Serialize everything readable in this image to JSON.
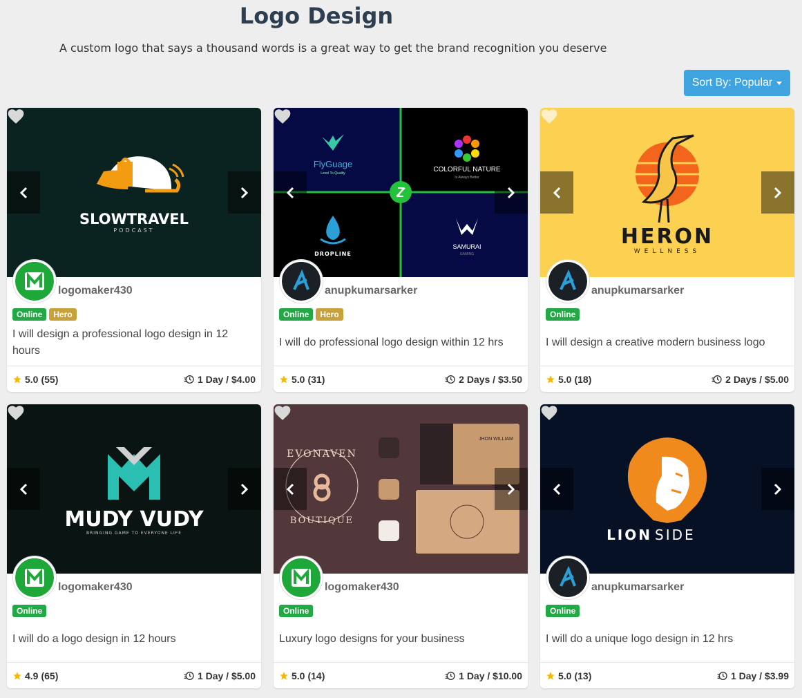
{
  "header": {
    "title": "Logo Design",
    "subtitle": "A custom logo that says a thousand words is a great way to get the brand recognition you deserve",
    "sort_label": "Sort By: Popular"
  },
  "colors": {
    "accent": "#3fa3e0",
    "online": "#22a845",
    "hero": "#c9a13b",
    "star": "#f5b800"
  },
  "cards": [
    {
      "image_text": {
        "line1": "SLOWTRAVEL",
        "line2": "PODCAST"
      },
      "seller": "logomaker430",
      "badges": {
        "online": "Online",
        "hero": "Hero"
      },
      "description": "I will design a professional logo design in 12 hours",
      "rating": "5.0",
      "reviews": "(55)",
      "delivery": "1 Day / $4.00",
      "favorited": false
    },
    {
      "image_text": {
        "a": "FlyGuage",
        "a_sub": "Level To Quality",
        "b": "COLORFUL NATURE",
        "b_sub": "Is Always Better",
        "c": "DROPLINE",
        "d": "SAMURAI",
        "d_sub": "GAMING"
      },
      "seller": "anupkumarsarker",
      "badges": {
        "online": "Online",
        "hero": "Hero"
      },
      "description": "I will do professional logo design within 12 hrs",
      "rating": "5.0",
      "reviews": "(31)",
      "delivery": "2 Days / $3.50",
      "favorited": false
    },
    {
      "image_text": {
        "line1": "HERON",
        "line2": "WELLNESS"
      },
      "seller": "anupkumarsarker",
      "badges": {
        "online": "Online"
      },
      "description": "I will design a creative modern business logo",
      "rating": "5.0",
      "reviews": "(18)",
      "delivery": "2 Days / $5.00",
      "favorited": true
    },
    {
      "image_text": {
        "line1": "MUDY VUDY",
        "line2": "BRINGING GAME TO EVERYONE LIFE"
      },
      "seller": "logomaker430",
      "badges": {
        "online": "Online"
      },
      "description": "I will do a logo design in 12 hours",
      "rating": "4.9",
      "reviews": "(65)",
      "delivery": "1 Day / $5.00",
      "favorited": false
    },
    {
      "image_text": {
        "line1": "EVONAVEN",
        "line2": "BOUTIQUE",
        "card_name": "JHON WILLIAM"
      },
      "seller": "logomaker430",
      "badges": {
        "online": "Online"
      },
      "description": "Luxury logo designs for your business",
      "rating": "5.0",
      "reviews": "(14)",
      "delivery": "1 Day / $10.00",
      "favorited": false
    },
    {
      "image_text": {
        "line1": "LION",
        "line2": "SIDE"
      },
      "seller": "anupkumarsarker",
      "badges": {
        "online": "Online"
      },
      "description": "I will do a unique logo design in 12 hrs",
      "rating": "5.0",
      "reviews": "(13)",
      "delivery": "1 Day / $3.99",
      "favorited": false
    }
  ]
}
